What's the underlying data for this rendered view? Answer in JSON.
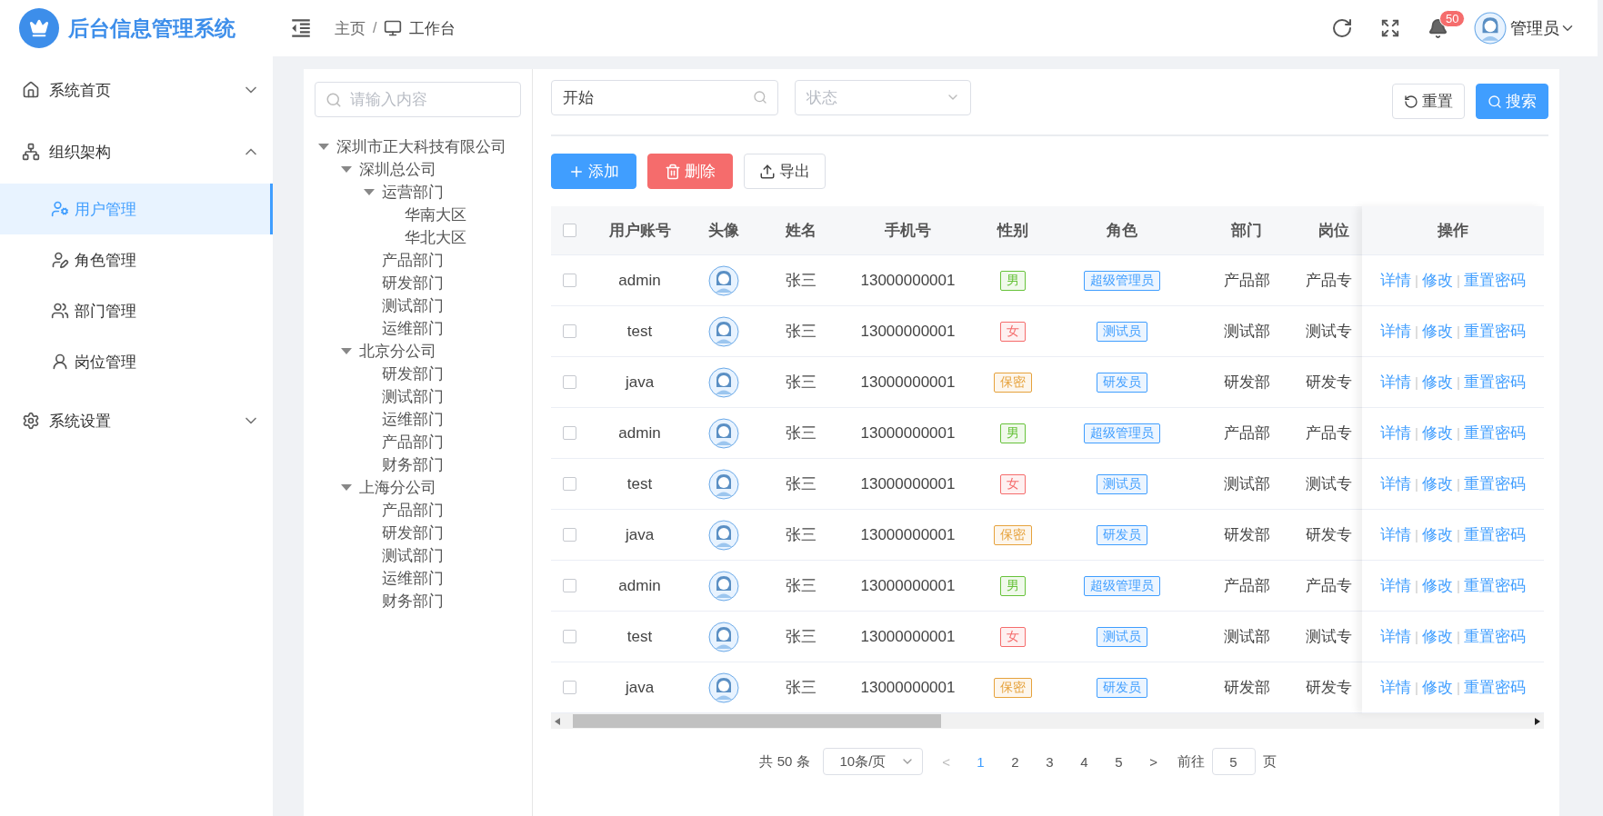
{
  "header": {
    "logo_title": "后台信息管理系统",
    "breadcrumb": [
      "主页",
      "工作台"
    ],
    "breadcrumb_separator": "/",
    "notification_count": "50",
    "user": "管理员"
  },
  "sidebar": {
    "items": [
      {
        "label": "系统首页",
        "expanded": false
      },
      {
        "label": "组织架构",
        "expanded": true,
        "children": [
          {
            "label": "用户管理",
            "selected": true
          },
          {
            "label": "角色管理",
            "selected": false
          },
          {
            "label": "部门管理",
            "selected": false
          },
          {
            "label": "岗位管理",
            "selected": false
          }
        ]
      },
      {
        "label": "系统设置",
        "expanded": false
      }
    ]
  },
  "tree": {
    "search_placeholder": "请输入内容",
    "nodes": [
      {
        "label": "深圳市正大科技有限公司",
        "expanded": true,
        "children": [
          {
            "label": "深圳总公司",
            "expanded": true,
            "children": [
              {
                "label": "运营部门",
                "expanded": true,
                "children": [
                  {
                    "label": "华南大区"
                  },
                  {
                    "label": "华北大区"
                  }
                ]
              },
              {
                "label": "产品部门"
              },
              {
                "label": "研发部门"
              },
              {
                "label": "测试部门"
              },
              {
                "label": "运维部门"
              }
            ]
          },
          {
            "label": "北京分公司",
            "expanded": true,
            "children": [
              {
                "label": "研发部门"
              },
              {
                "label": "测试部门"
              },
              {
                "label": "运维部门"
              },
              {
                "label": "产品部门"
              },
              {
                "label": "财务部门"
              }
            ]
          },
          {
            "label": "上海分公司",
            "expanded": true,
            "children": [
              {
                "label": "产品部门"
              },
              {
                "label": "研发部门"
              },
              {
                "label": "测试部门"
              },
              {
                "label": "运维部门"
              },
              {
                "label": "财务部门"
              }
            ]
          }
        ]
      }
    ]
  },
  "filters": {
    "keyword_value": "开始",
    "status_placeholder": "状态",
    "buttons": [
      "重置",
      "搜索"
    ]
  },
  "toolbar": {
    "buttons": [
      "添加",
      "删除",
      "导出"
    ]
  },
  "table": {
    "select_all_checked": false,
    "columns": [
      "用户账号",
      "头像",
      "姓名",
      "手机号",
      "性别",
      "角色",
      "部门",
      "岗位",
      "操作"
    ],
    "rows": [
      {
        "checked": false,
        "account": "admin",
        "name": "张三",
        "phone": "13000000001",
        "gender": {
          "label": "男",
          "color": "#67c23a"
        },
        "role": "超级管理员",
        "dept": "产品部",
        "post": "产品专",
        "actions": [
          "详情",
          "修改",
          "重置密码"
        ],
        "separators": [
          "|",
          "|"
        ]
      },
      {
        "checked": false,
        "account": "test",
        "name": "张三",
        "phone": "13000000001",
        "gender": {
          "label": "女",
          "color": "#f56c6c"
        },
        "role": "测试员",
        "dept": "测试部",
        "post": "测试专",
        "actions": [
          "详情",
          "修改",
          "重置密码"
        ],
        "separators": [
          "|",
          "|"
        ]
      },
      {
        "checked": false,
        "account": "java",
        "name": "张三",
        "phone": "13000000001",
        "gender": {
          "label": "保密",
          "color": "#e6a23c"
        },
        "role": "研发员",
        "dept": "研发部",
        "post": "研发专",
        "actions": [
          "详情",
          "修改",
          "重置密码"
        ],
        "separators": [
          "|",
          "|"
        ]
      },
      {
        "checked": false,
        "account": "admin",
        "name": "张三",
        "phone": "13000000001",
        "gender": {
          "label": "男",
          "color": "#67c23a"
        },
        "role": "超级管理员",
        "dept": "产品部",
        "post": "产品专",
        "actions": [
          "详情",
          "修改",
          "重置密码"
        ],
        "separators": [
          "|",
          "|"
        ]
      },
      {
        "checked": false,
        "account": "test",
        "name": "张三",
        "phone": "13000000001",
        "gender": {
          "label": "女",
          "color": "#f56c6c"
        },
        "role": "测试员",
        "dept": "测试部",
        "post": "测试专",
        "actions": [
          "详情",
          "修改",
          "重置密码"
        ],
        "separators": [
          "|",
          "|"
        ]
      },
      {
        "checked": false,
        "account": "java",
        "name": "张三",
        "phone": "13000000001",
        "gender": {
          "label": "保密",
          "color": "#e6a23c"
        },
        "role": "研发员",
        "dept": "研发部",
        "post": "研发专",
        "actions": [
          "详情",
          "修改",
          "重置密码"
        ],
        "separators": [
          "|",
          "|"
        ]
      },
      {
        "checked": false,
        "account": "admin",
        "name": "张三",
        "phone": "13000000001",
        "gender": {
          "label": "男",
          "color": "#67c23a"
        },
        "role": "超级管理员",
        "dept": "产品部",
        "post": "产品专",
        "actions": [
          "详情",
          "修改",
          "重置密码"
        ],
        "separators": [
          "|",
          "|"
        ]
      },
      {
        "checked": false,
        "account": "test",
        "name": "张三",
        "phone": "13000000001",
        "gender": {
          "label": "女",
          "color": "#f56c6c"
        },
        "role": "测试员",
        "dept": "测试部",
        "post": "测试专",
        "actions": [
          "详情",
          "修改",
          "重置密码"
        ],
        "separators": [
          "|",
          "|"
        ]
      },
      {
        "checked": false,
        "account": "java",
        "name": "张三",
        "phone": "13000000001",
        "gender": {
          "label": "保密",
          "color": "#e6a23c"
        },
        "role": "研发员",
        "dept": "研发部",
        "post": "研发专",
        "actions": [
          "详情",
          "修改",
          "重置密码"
        ],
        "separators": [
          "|",
          "|"
        ]
      }
    ]
  },
  "pagination": {
    "total": "共 50 条",
    "page_size": "10条/页",
    "prev": "<",
    "pages": [
      {
        "label": "1",
        "selected": true
      },
      {
        "label": "2",
        "selected": false
      },
      {
        "label": "3",
        "selected": false
      },
      {
        "label": "4",
        "selected": false
      },
      {
        "label": "5",
        "selected": false
      }
    ],
    "next": ">",
    "goto_label": "前往",
    "goto_value": "5",
    "goto_suffix": "页"
  }
}
